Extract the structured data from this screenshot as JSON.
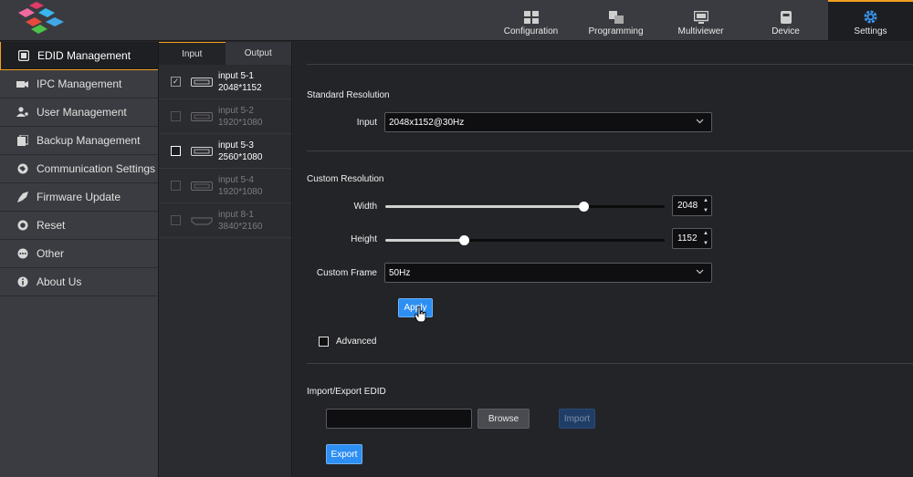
{
  "topnav": [
    {
      "label": "Configuration",
      "icon": "configuration-icon"
    },
    {
      "label": "Programming",
      "icon": "programming-icon"
    },
    {
      "label": "Multiviewer",
      "icon": "monitor-icon"
    },
    {
      "label": "Device",
      "icon": "device-icon"
    },
    {
      "label": "Settings",
      "icon": "gear-icon",
      "active": true
    }
  ],
  "sidebar": {
    "items": [
      {
        "label": "EDID Management",
        "icon": "edid-icon",
        "active": true
      },
      {
        "label": "IPC Management",
        "icon": "ipc-icon"
      },
      {
        "label": "User Management",
        "icon": "user-icon"
      },
      {
        "label": "Backup Management",
        "icon": "backup-icon"
      },
      {
        "label": "Communication Settings",
        "icon": "communication-icon"
      },
      {
        "label": "Firmware Update",
        "icon": "rocket-icon"
      },
      {
        "label": "Reset",
        "icon": "reset-icon"
      },
      {
        "label": "Other",
        "icon": "more-icon"
      },
      {
        "label": "About Us",
        "icon": "info-icon"
      }
    ]
  },
  "tabs": {
    "input": "Input",
    "output": "Output"
  },
  "inputs": [
    {
      "name": "input 5-1",
      "resolution": "2048*1152",
      "enabled": true,
      "checked": true,
      "port": "dvi"
    },
    {
      "name": "input 5-2",
      "resolution": "1920*1080",
      "enabled": false,
      "checked": false,
      "port": "dvi"
    },
    {
      "name": "input 5-3",
      "resolution": "2560*1080",
      "enabled": true,
      "checked": false,
      "port": "dvi"
    },
    {
      "name": "input 5-4",
      "resolution": "1920*1080",
      "enabled": false,
      "checked": false,
      "port": "dvi"
    },
    {
      "name": "input 8-1",
      "resolution": "3840*2160",
      "enabled": false,
      "checked": false,
      "port": "hdmi"
    }
  ],
  "standard": {
    "title": "Standard Resolution",
    "input_label": "Input",
    "input_value": "2048x1152@30Hz"
  },
  "custom": {
    "title": "Custom Resolution",
    "width_label": "Width",
    "width_value": "2048",
    "width_fraction": 0.71,
    "height_label": "Height",
    "height_value": "1152",
    "height_fraction": 0.28,
    "frame_label": "Custom Frame",
    "frame_value": "50Hz",
    "apply_label": "Apply",
    "advanced_label": "Advanced"
  },
  "import_export": {
    "title": "Import/Export EDID",
    "browse_label": "Browse",
    "import_label": "Import",
    "export_label": "Export"
  },
  "colors": {
    "accent": "#f2a01e",
    "primary_button": "#2d8ef3"
  }
}
